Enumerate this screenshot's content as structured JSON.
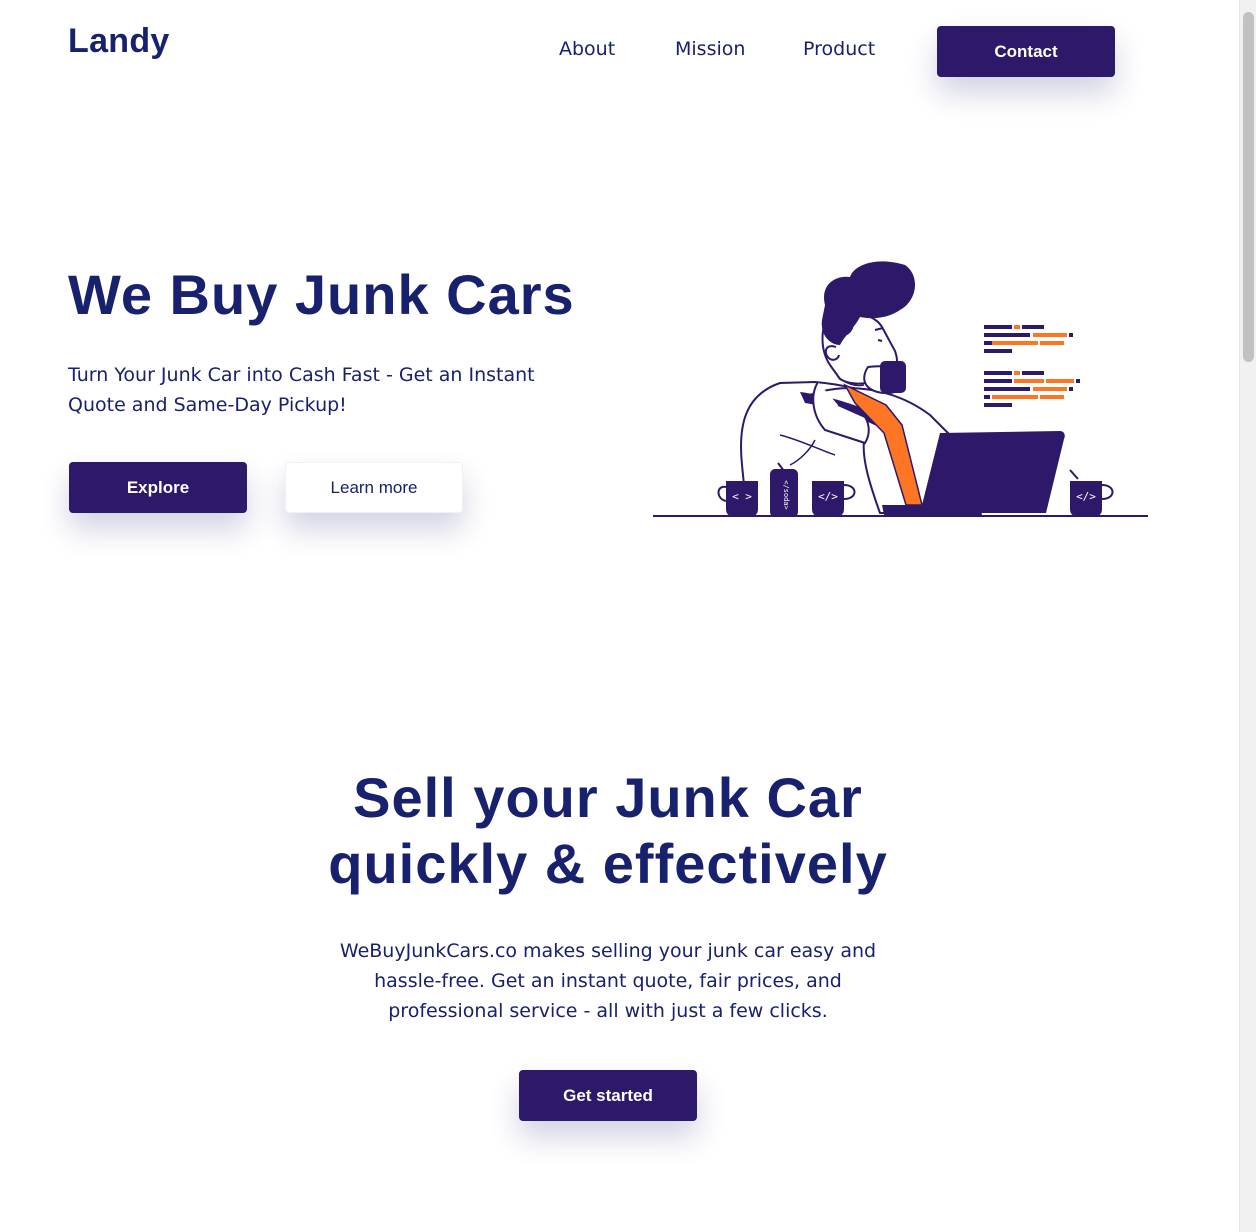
{
  "header": {
    "logo": "Landy",
    "nav": {
      "about": "About",
      "mission": "Mission",
      "product": "Product",
      "contact": "Contact"
    }
  },
  "hero": {
    "title": "We Buy Junk Cars",
    "subtitle": "Turn Your Junk Car into Cash Fast - Get an Instant Quote and Same-Day Pickup!",
    "explore_label": "Explore",
    "learn_more_label": "Learn more",
    "illustration": {
      "mug_left_glyph": "< >",
      "can_glyph": "</soda>",
      "mug_mid_glyph": "</>",
      "mug_right_glyph": "</>"
    }
  },
  "section": {
    "title_line1": "Sell your Junk Car",
    "title_line2": "quickly & effectively",
    "text": "WeBuyJunkCars.co makes selling your junk car easy and hassle-free. Get an instant quote, fair prices, and professional service - all with just a few clicks.",
    "cta_label": "Get started"
  },
  "colors": {
    "primary": "#2e186a",
    "text": "#18216d",
    "accent": "#fe7624"
  },
  "icons": {
    "illustration": "developer-drinking-coffee-illustration"
  }
}
